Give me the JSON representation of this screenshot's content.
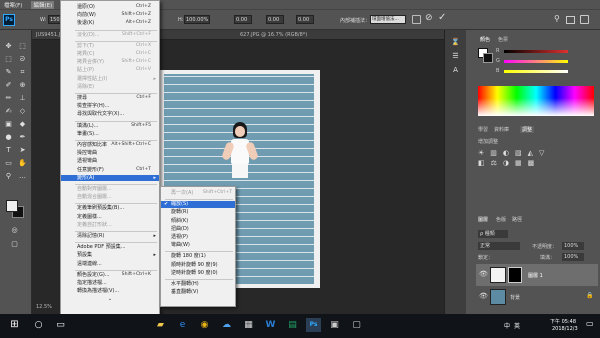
{
  "menubar": {
    "items": [
      "檔案(F)",
      "編輯(E)"
    ]
  },
  "optbar": {
    "ps": "Ps",
    "w_label": "W:",
    "w_value": "1502",
    "h_label": "H:",
    "h_value": "100.00%",
    "angle_value": "0.00",
    "h2_value": "0.00",
    "v_value": "0.00",
    "interp_label": "內部補插法：",
    "interp_value": "環面增值法..."
  },
  "document": {
    "tab_title": "JUS9451.JP...",
    "tab_title2": "627.JPG @ 16.7% (RGB/8*)",
    "status_zoom": "12.5%"
  },
  "edit_menu": {
    "items": [
      {
        "label": "還原(O)",
        "shortcut": "Ctrl+Z",
        "disabled": false
      },
      {
        "label": "向前(W)",
        "shortcut": "Shift+Ctrl+Z",
        "disabled": false
      },
      {
        "label": "後退(K)",
        "shortcut": "Alt+Ctrl+Z",
        "disabled": false
      },
      {
        "label": "淡化(D)...",
        "shortcut": "Shift+Ctrl+F",
        "disabled": true
      },
      {
        "label": "剪下(T)",
        "shortcut": "Ctrl+X",
        "disabled": true
      },
      {
        "label": "拷貝(C)",
        "shortcut": "Ctrl+C",
        "disabled": true
      },
      {
        "label": "拷貝合併(Y)",
        "shortcut": "Shift+Ctrl+C",
        "disabled": true
      },
      {
        "label": "貼上(P)",
        "shortcut": "Ctrl+V",
        "disabled": true
      },
      {
        "label": "選擇性貼上(I)",
        "shortcut": "",
        "disabled": true,
        "submenu": true
      },
      {
        "label": "清除(E)",
        "shortcut": "",
        "disabled": true
      },
      {
        "label": "搜尋",
        "shortcut": "Ctrl+F",
        "disabled": false
      },
      {
        "label": "檢查拼字(H)...",
        "shortcut": "",
        "disabled": false
      },
      {
        "label": "尋找與取代文字(X)...",
        "shortcut": "",
        "disabled": false
      },
      {
        "label": "填滿(L)...",
        "shortcut": "Shift+F5",
        "disabled": false
      },
      {
        "label": "筆畫(S)...",
        "shortcut": "",
        "disabled": false
      },
      {
        "label": "內容感知比率",
        "shortcut": "Alt+Shift+Ctrl+C",
        "disabled": false
      },
      {
        "label": "操控彎曲",
        "shortcut": "",
        "disabled": false
      },
      {
        "label": "透視彎曲",
        "shortcut": "",
        "disabled": false
      },
      {
        "label": "任意變形(F)",
        "shortcut": "Ctrl+T",
        "disabled": false
      },
      {
        "label": "變形(A)",
        "shortcut": "",
        "disabled": false,
        "submenu": true,
        "highlighted": true
      },
      {
        "label": "自動對齊圖層...",
        "shortcut": "",
        "disabled": true
      },
      {
        "label": "自動混合圖層...",
        "shortcut": "",
        "disabled": true
      },
      {
        "label": "定義筆刷預設集(B)...",
        "shortcut": "",
        "disabled": false
      },
      {
        "label": "定義圖樣...",
        "shortcut": "",
        "disabled": false
      },
      {
        "label": "定義自訂形狀...",
        "shortcut": "",
        "disabled": true
      },
      {
        "label": "清除記憶(R)",
        "shortcut": "",
        "disabled": false,
        "submenu": true
      },
      {
        "label": "Adobe PDF 預設集...",
        "shortcut": "",
        "disabled": false
      },
      {
        "label": "預設集",
        "shortcut": "",
        "disabled": false,
        "submenu": true
      },
      {
        "label": "遠端連線...",
        "shortcut": "",
        "disabled": false
      },
      {
        "label": "顏色設定(G)...",
        "shortcut": "Shift+Ctrl+K",
        "disabled": false
      },
      {
        "label": "指定描述檔...",
        "shortcut": "",
        "disabled": false
      },
      {
        "label": "轉換為描述檔(V)...",
        "shortcut": "",
        "disabled": false
      }
    ],
    "more_arrow": "⌄"
  },
  "transform_submenu": {
    "items": [
      {
        "label": "再一次(A)",
        "shortcut": "Shift+Ctrl+T",
        "disabled": true
      },
      {
        "label": "縮放(S)",
        "shortcut": "",
        "highlighted": true,
        "checked": true
      },
      {
        "label": "旋轉(R)",
        "shortcut": ""
      },
      {
        "label": "傾斜(K)",
        "shortcut": ""
      },
      {
        "label": "扭曲(D)",
        "shortcut": ""
      },
      {
        "label": "透視(P)",
        "shortcut": ""
      },
      {
        "label": "彎曲(W)",
        "shortcut": ""
      },
      {
        "label": "旋轉 180 度(1)",
        "shortcut": ""
      },
      {
        "label": "順時針旋轉 90 度(9)",
        "shortcut": ""
      },
      {
        "label": "逆時針旋轉 90 度(0)",
        "shortcut": ""
      },
      {
        "label": "水平翻轉(H)",
        "shortcut": ""
      },
      {
        "label": "垂直翻轉(V)",
        "shortcut": ""
      }
    ],
    "check": "✔"
  },
  "right_panel": {
    "color_tabs": [
      "顏色",
      "色票"
    ],
    "sliders": [
      {
        "label": "R",
        "color": "#e03030"
      },
      {
        "label": "G",
        "color": "#30c030"
      },
      {
        "label": "B",
        "color": "#3070e0"
      }
    ],
    "mid_tabs": [
      "學習",
      "資料庫",
      "調整"
    ],
    "adjust_label": "增加調整",
    "layer_tabs": [
      "圖層",
      "色版",
      "路徑"
    ],
    "kind_label": "ρ 種類",
    "blend_mode": "正常",
    "opacity_label": "不透明度：",
    "opacity_value": "100%",
    "lock_label": "鎖定：",
    "fill_label": "填滿：",
    "fill_value": "100%",
    "layers": [
      {
        "name": "圖層 1",
        "selected": true
      },
      {
        "name": "背景",
        "selected": false
      }
    ]
  },
  "taskbar": {
    "tray_lang": "中",
    "tray_ime": "英",
    "time": "下午 05:48",
    "date": "2018/12/3"
  }
}
